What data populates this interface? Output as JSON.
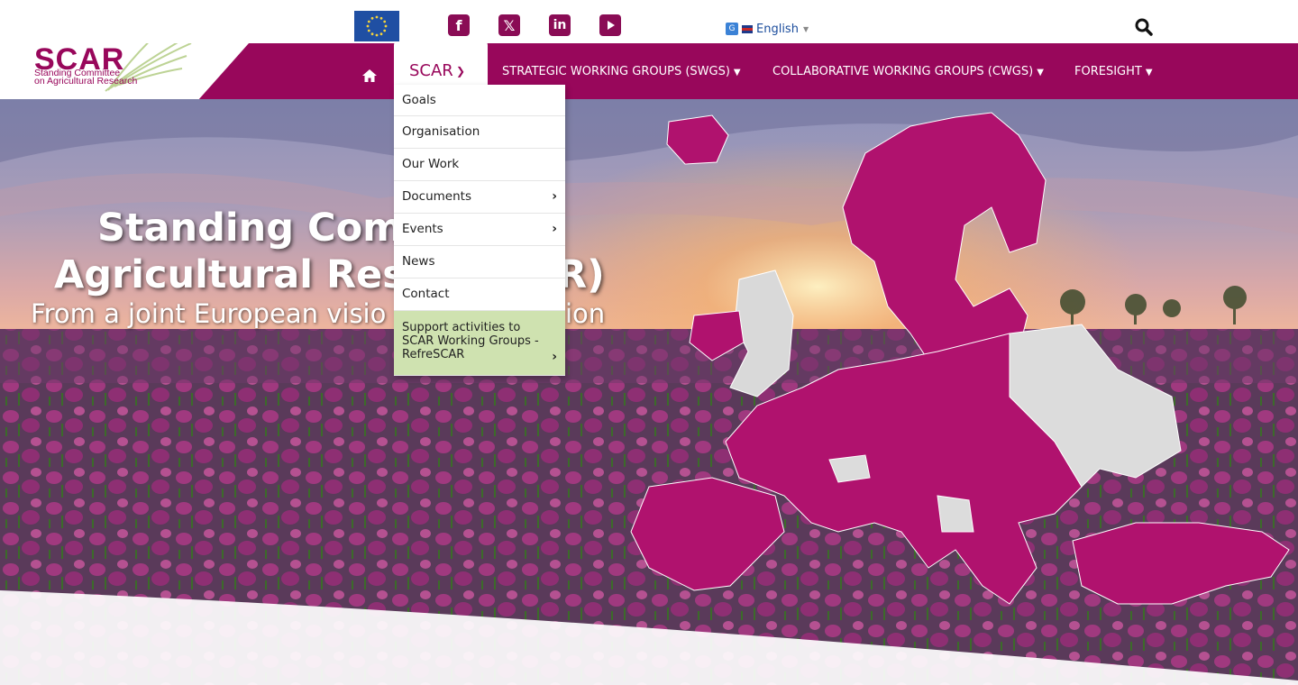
{
  "topbar": {
    "social": {
      "facebook": "f",
      "x": "𝕏",
      "linkedin": "in"
    },
    "language": {
      "label": "English"
    }
  },
  "logo": {
    "title": "SCAR",
    "subtitle_line1": "Standing Committee",
    "subtitle_line2": "on Agricultural Research"
  },
  "nav": {
    "active_label": "SCAR",
    "items": [
      {
        "label": "STRATEGIC WORKING GROUPS (SWGS)"
      },
      {
        "label": "COLLABORATIVE WORKING GROUPS (CWGS)"
      },
      {
        "label": "FORESIGHT"
      }
    ]
  },
  "dropdown": {
    "items": [
      {
        "label": "Goals"
      },
      {
        "label": "Organisation"
      },
      {
        "label": "Our Work"
      },
      {
        "label": "Documents"
      },
      {
        "label": "Events"
      },
      {
        "label": "News"
      },
      {
        "label": "Contact"
      },
      {
        "label": "Support activities to SCAR Working Groups - RefreSCAR"
      }
    ]
  },
  "hero": {
    "title_line1": "Standing Comm",
    "title_line2": "Agricultural Resea",
    "title_line2_tail": "R)",
    "subtitle": "From a joint European visio",
    "subtitle_tail": "ion"
  },
  "colors": {
    "brand": "#98075b",
    "menu_highlight": "#cfe2b0",
    "map": "#b0126e",
    "map_grey": "#dcdcdc"
  },
  "icons": [
    "eu-flag-icon",
    "facebook-icon",
    "x-icon",
    "linkedin-icon",
    "youtube-icon",
    "google-translate-icon",
    "search-icon",
    "home-icon",
    "chevron-down-icon",
    "chevron-right-icon"
  ]
}
